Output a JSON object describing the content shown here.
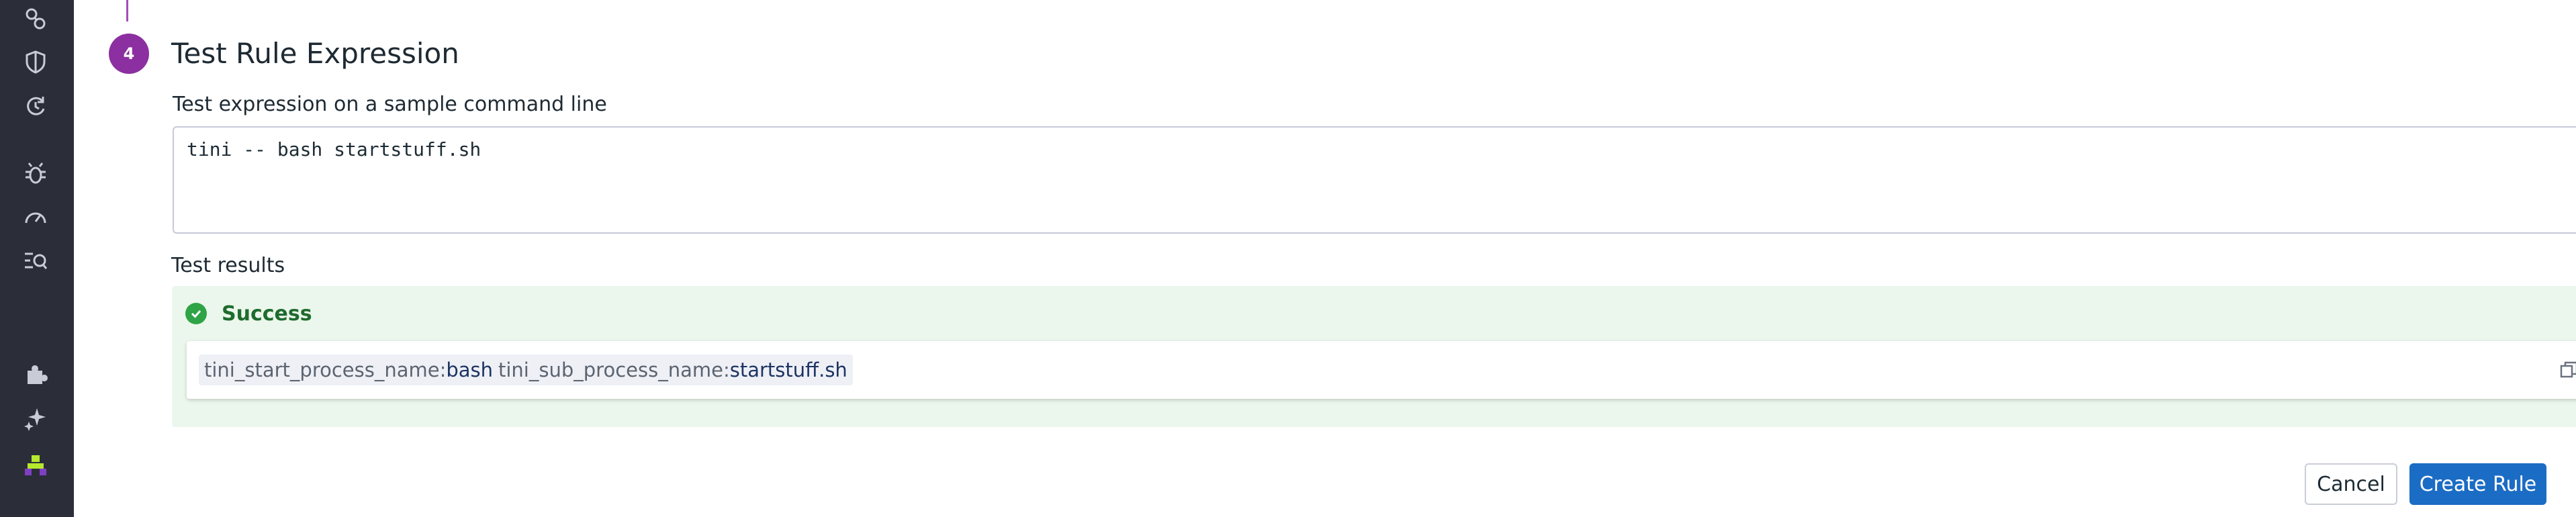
{
  "sidebar": {
    "icons": [
      {
        "name": "link-icon"
      },
      {
        "name": "shield-icon"
      },
      {
        "name": "refresh-icon"
      },
      {
        "name": "bug-icon"
      },
      {
        "name": "gauge-icon"
      },
      {
        "name": "search-list-icon"
      },
      {
        "name": "puzzle-icon"
      },
      {
        "name": "sparkle-icon"
      },
      {
        "name": "user-pixel-icon"
      }
    ]
  },
  "step": {
    "number": "4",
    "title": "Test Rule Expression"
  },
  "expression": {
    "label": "Test expression on a sample command line",
    "value": "tini -- bash startstuff.sh"
  },
  "results": {
    "label": "Test results",
    "status": "Success",
    "tags": [
      {
        "key": "tini_start_process_name:",
        "value": "bash"
      },
      {
        "key": "tini_sub_process_name:",
        "value": "startstuff.sh"
      }
    ]
  },
  "actions": {
    "cancel_label": "Cancel",
    "create_label": "Create Rule"
  },
  "colors": {
    "sidebar_bg": "#2b2d39",
    "step_badge": "#8c2fa0",
    "success_bg": "#ebf7ec",
    "success_green": "#2ea446",
    "primary_button": "#1b6cc4"
  }
}
